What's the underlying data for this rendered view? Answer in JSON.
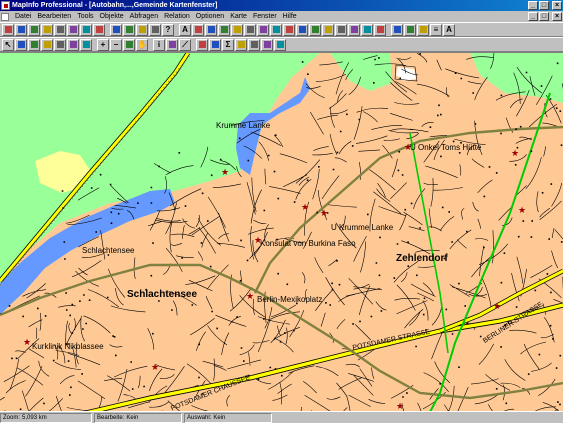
{
  "window": {
    "title": "MapInfo Professional - [Autobahn,...,Gemeinde Kartenfenster]",
    "caption_buttons": [
      "_",
      "□",
      "×"
    ],
    "mdi_buttons": [
      "_",
      "□",
      "×"
    ]
  },
  "menu": {
    "items": [
      "Datei",
      "Bearbeiten",
      "Tools",
      "Objekte",
      "Abfragen",
      "Relation",
      "Optionen",
      "Karte",
      "Fenster",
      "Hilfe"
    ]
  },
  "toolbar1": {
    "icons": [
      "new-icon",
      "open-icon",
      "save-icon",
      "print-icon",
      "cut-icon",
      "copy-icon",
      "paste-icon",
      "undo-icon",
      "new-mapper-icon",
      "new-browser-icon",
      "new-grapher-icon",
      "new-layout-icon",
      "help-icon",
      "text-tool-icon",
      "frame-tool-icon",
      "symbol-tool-icon",
      "line-tool-icon",
      "polyline-tool-icon",
      "arc-tool-icon",
      "polygon-tool-icon",
      "ellipse-tool-icon",
      "rectangle-tool-icon",
      "rounded-rect-tool-icon",
      "reshape-icon",
      "add-node-icon",
      "symbol-style-icon",
      "line-style-icon",
      "region-style-icon",
      "text-style-icon",
      "run-app-icon",
      "routing-icon",
      "map-network-icon",
      "label-icon",
      "font-icon"
    ]
  },
  "toolbar2": {
    "icons": [
      "select-icon",
      "marquee-select-icon",
      "radius-select-icon",
      "polygon-select-icon",
      "boundary-select-icon",
      "unselect-all-icon",
      "invert-selection-icon",
      "zoom-in-icon",
      "zoom-out-icon",
      "change-view-icon",
      "grabber-icon",
      "info-icon",
      "hotlink-icon",
      "ruler-icon",
      "layer-control-icon",
      "legend-icon",
      "statistics-icon",
      "cosmetic-layer-icon",
      "drag-map-icon",
      "thematic-map-icon",
      "graph-icon"
    ]
  },
  "map": {
    "colors": {
      "land": "#ffc995",
      "park": "#99ff99",
      "water": "#6699ff",
      "sand": "#ffff99",
      "street": "#000000",
      "highway": "#ffff00",
      "rail": "#808040",
      "green_line": "#00cc00"
    },
    "labels": {
      "krumme_lanke": "Krumme Lanke",
      "onkel_toms": "U Onkel Toms Hütte",
      "u_krumme_lanke": "U Krumme Lanke",
      "konsulat": "Konsulat von Burkina Faso",
      "schlachtensee_lake": "Schlachtensee",
      "zehlendorf": "Zehlendorf",
      "schlachtensee_district": "Schlachtensee",
      "mexikoplatz": "Berlin-Mexikoplatz",
      "kurklinik": "Kurklinik Nikolassee",
      "potsdamer_strasse": "POTSDAMER STRASSE",
      "potsdamer_chaussee": "POTSDAMER CHAUSSEE",
      "berliner_strasse": "BERLINER STRASSE"
    }
  },
  "status": {
    "zoom_label": "Zoom:",
    "zoom_value": "5,093 km",
    "edit_label": "Bearbeite:",
    "edit_value": "Kein",
    "select_label": "Auswahl:",
    "select_value": "Kein"
  }
}
